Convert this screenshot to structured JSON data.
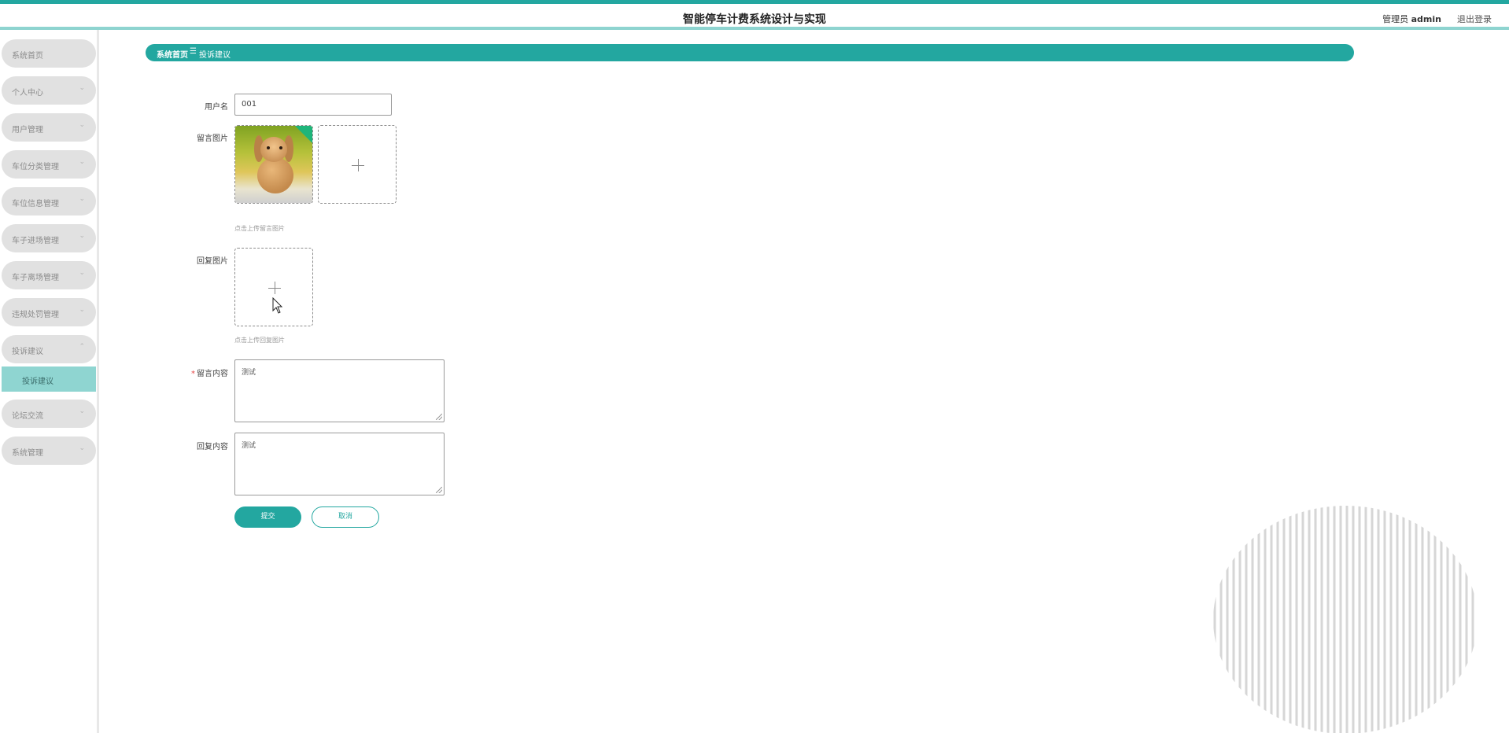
{
  "header": {
    "title": "智能停车计费系统设计与实现",
    "role": "管理员",
    "username": "admin",
    "logout": "退出登录"
  },
  "sidebar": {
    "items": [
      {
        "label": "系统首页",
        "chevron": ""
      },
      {
        "label": "个人中心",
        "chevron": "⌄"
      },
      {
        "label": "用户管理",
        "chevron": "⌄"
      },
      {
        "label": "车位分类管理",
        "chevron": "⌄"
      },
      {
        "label": "车位信息管理",
        "chevron": "⌄"
      },
      {
        "label": "车子进场管理",
        "chevron": "⌄"
      },
      {
        "label": "车子离场管理",
        "chevron": "⌄"
      },
      {
        "label": "违规处罚管理",
        "chevron": "⌄"
      },
      {
        "label": "投诉建议",
        "chevron": "⌃"
      },
      {
        "label": "论坛交流",
        "chevron": "⌄"
      },
      {
        "label": "系统管理",
        "chevron": "⌄"
      }
    ],
    "active_sub": "投诉建议"
  },
  "breadcrumb": {
    "home": "系统首页",
    "separator": "☰",
    "current": "投诉建议"
  },
  "form": {
    "username_label": "用户名",
    "username_value": "001",
    "message_image_label": "留言图片",
    "message_image_hint": "点击上传留言图片",
    "reply_image_label": "回复图片",
    "reply_image_hint": "点击上传回复图片",
    "message_content_label": "留言内容",
    "message_content_value": "测试",
    "reply_content_label": "回复内容",
    "reply_content_value": "测试",
    "submit_label": "提交",
    "cancel_label": "取消"
  },
  "colors": {
    "accent": "#23a7a0",
    "accent_light": "#8fd5d1",
    "menu_bg": "#e1e1e1"
  }
}
